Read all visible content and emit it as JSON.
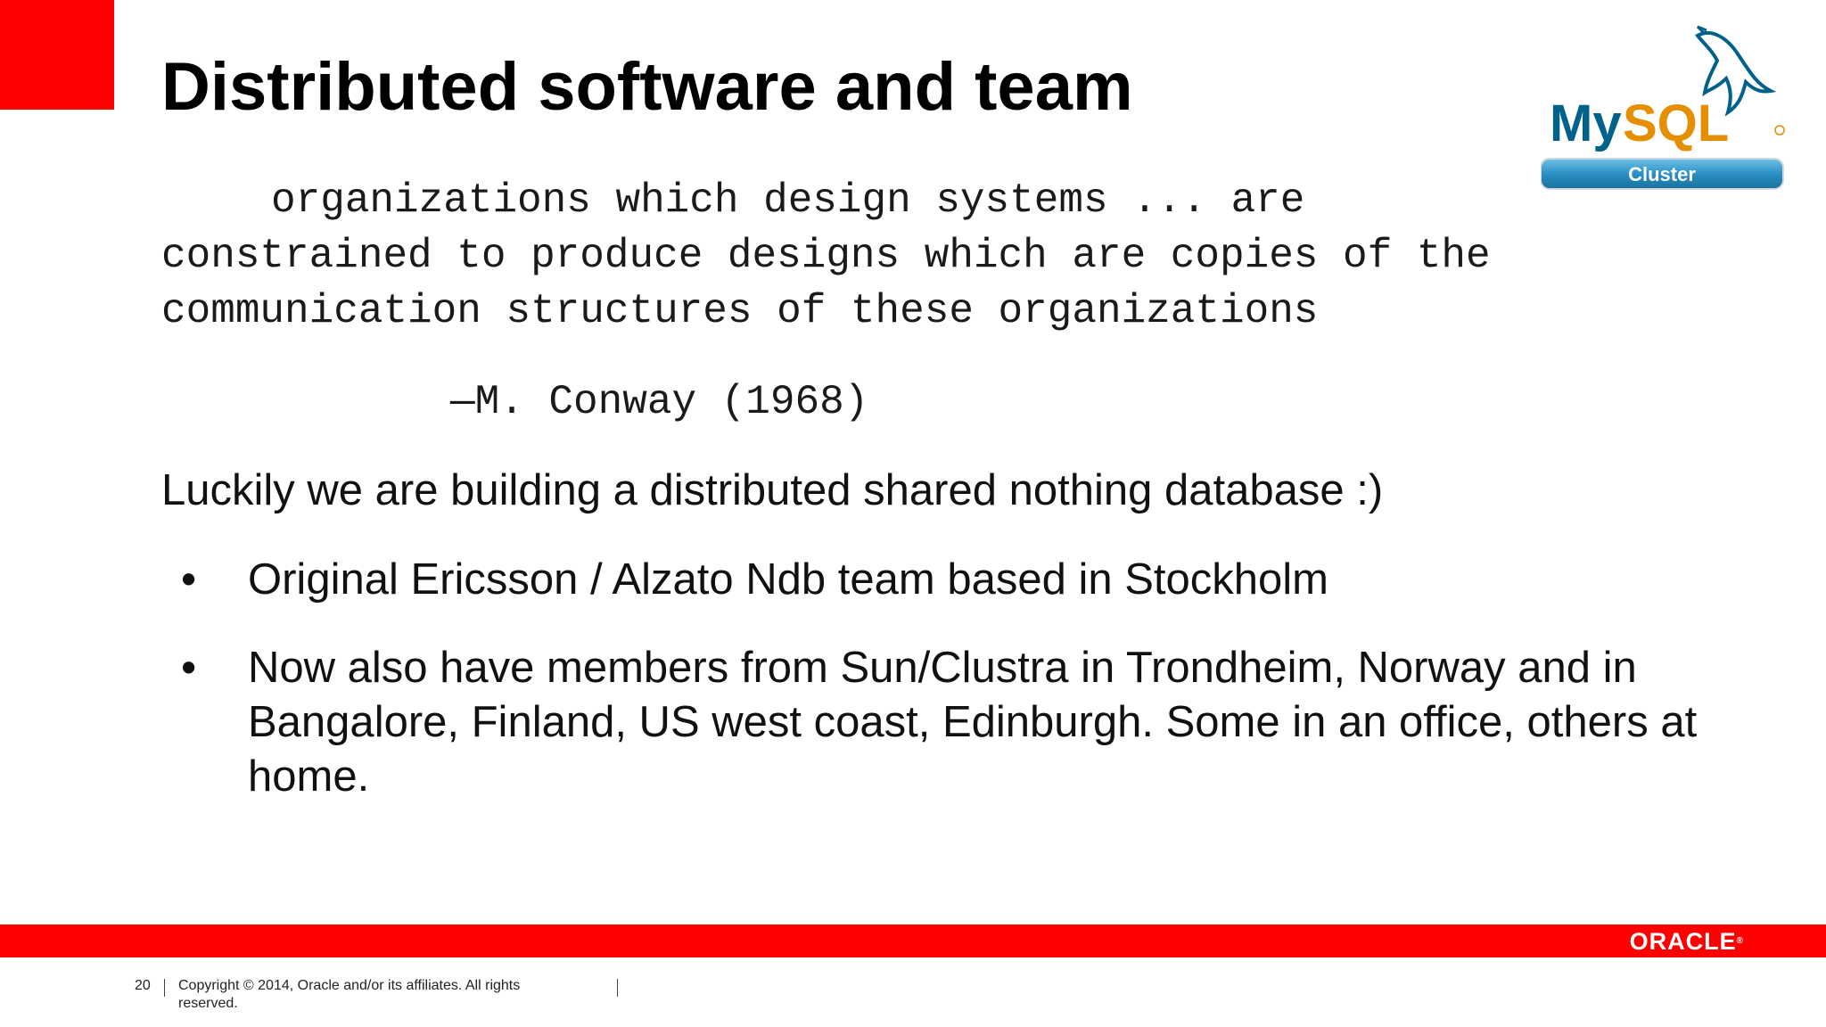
{
  "slide": {
    "title": "Distributed software and team",
    "quote_lines": [
      "organizations which design systems ... are",
      "constrained to produce designs which are copies of the",
      "communication structures of these organizations"
    ],
    "attribution": "—M. Conway (1968)",
    "lead": "Luckily we are building a distributed shared nothing database :)",
    "bullets": [
      "Original Ericsson / Alzato Ndb team based in Stockholm",
      "Now also have members from Sun/Clustra in Trondheim, Norway and in Bangalore, Finland, US west coast, Edinburgh.  Some in an office, others at home."
    ],
    "bullet_symbol": "•"
  },
  "logo": {
    "mysql_text": "MySQL",
    "cluster_text": "Cluster",
    "icon": "dolphin-icon",
    "colors": {
      "mysql_blue": "#00618a",
      "mysql_orange": "#e48e00",
      "badge": "#2b90c4"
    }
  },
  "footer": {
    "page_number": "20",
    "copyright": "Copyright © 2014, Oracle and/or its affiliates. All rights reserved.",
    "oracle_logo": "ORACLE"
  },
  "colors": {
    "accent": "#ff0000",
    "text": "#000000"
  }
}
